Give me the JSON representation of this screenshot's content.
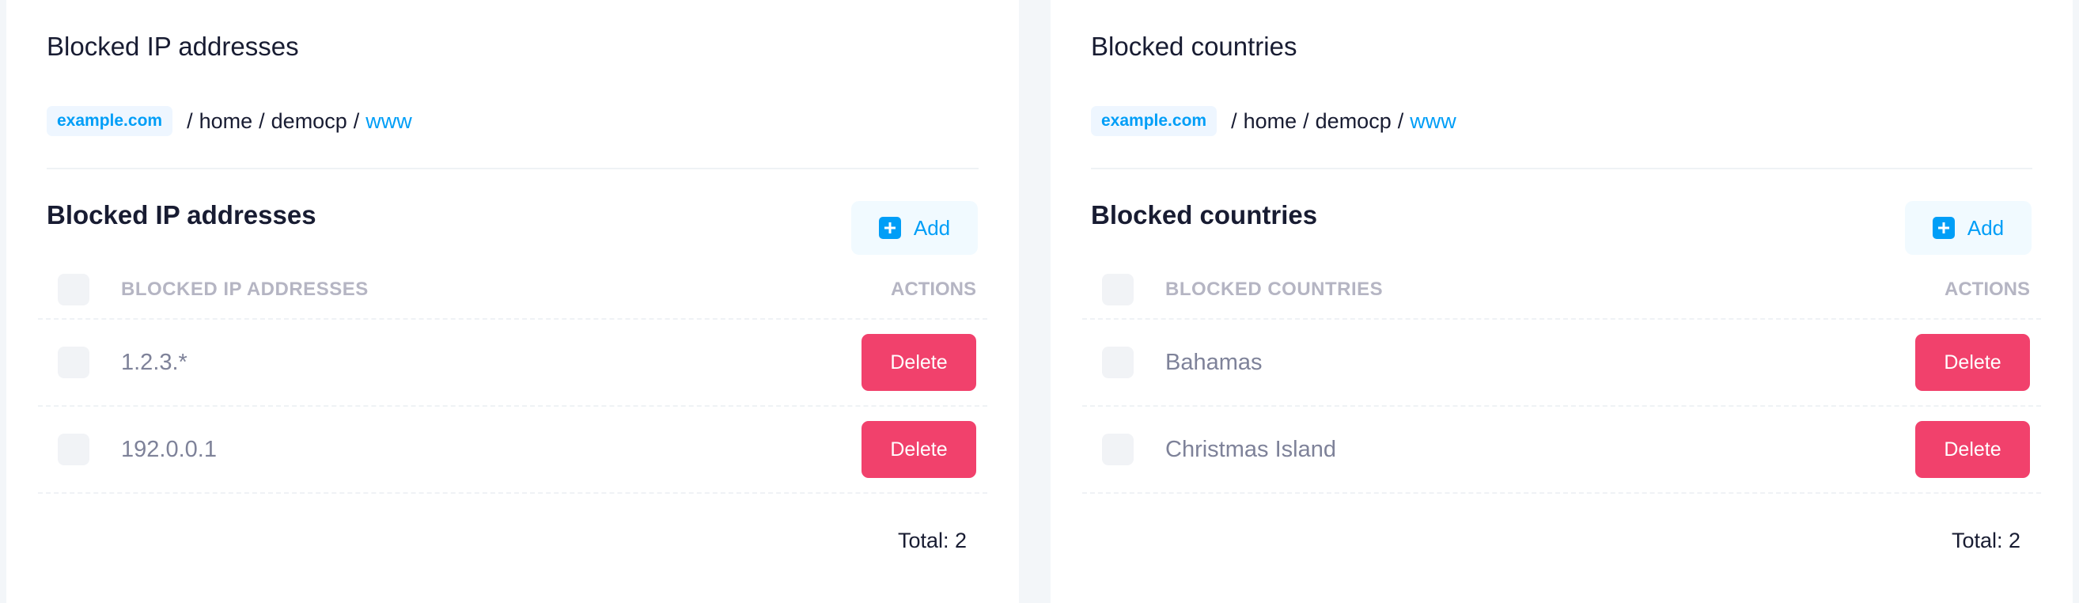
{
  "panels": [
    {
      "title": "Blocked IP addresses",
      "breadcrumb": {
        "domain": "example.com",
        "parts": [
          "home",
          "democp"
        ],
        "last": "www"
      },
      "section_title": "Blocked IP addresses",
      "add_label": "Add",
      "columns": {
        "main": "BLOCKED IP ADDRESSES",
        "actions": "ACTIONS"
      },
      "rows": [
        {
          "value": "1.2.3.*",
          "action": "Delete"
        },
        {
          "value": "192.0.0.1",
          "action": "Delete"
        }
      ],
      "total": "Total: 2"
    },
    {
      "title": "Blocked countries",
      "breadcrumb": {
        "domain": "example.com",
        "parts": [
          "home",
          "democp"
        ],
        "last": "www"
      },
      "section_title": "Blocked countries",
      "add_label": "Add",
      "columns": {
        "main": "BLOCKED COUNTRIES",
        "actions": "ACTIONS"
      },
      "rows": [
        {
          "value": "Bahamas",
          "action": "Delete"
        },
        {
          "value": "Christmas Island",
          "action": "Delete"
        }
      ],
      "total": "Total: 2"
    }
  ],
  "colors": {
    "accent": "#009ef7",
    "danger": "#f1416c",
    "text_dark": "#181c32",
    "text_muted": "#7e8299",
    "header_muted": "#b5b5c3"
  },
  "icons": {
    "add": "plus-square-icon"
  }
}
